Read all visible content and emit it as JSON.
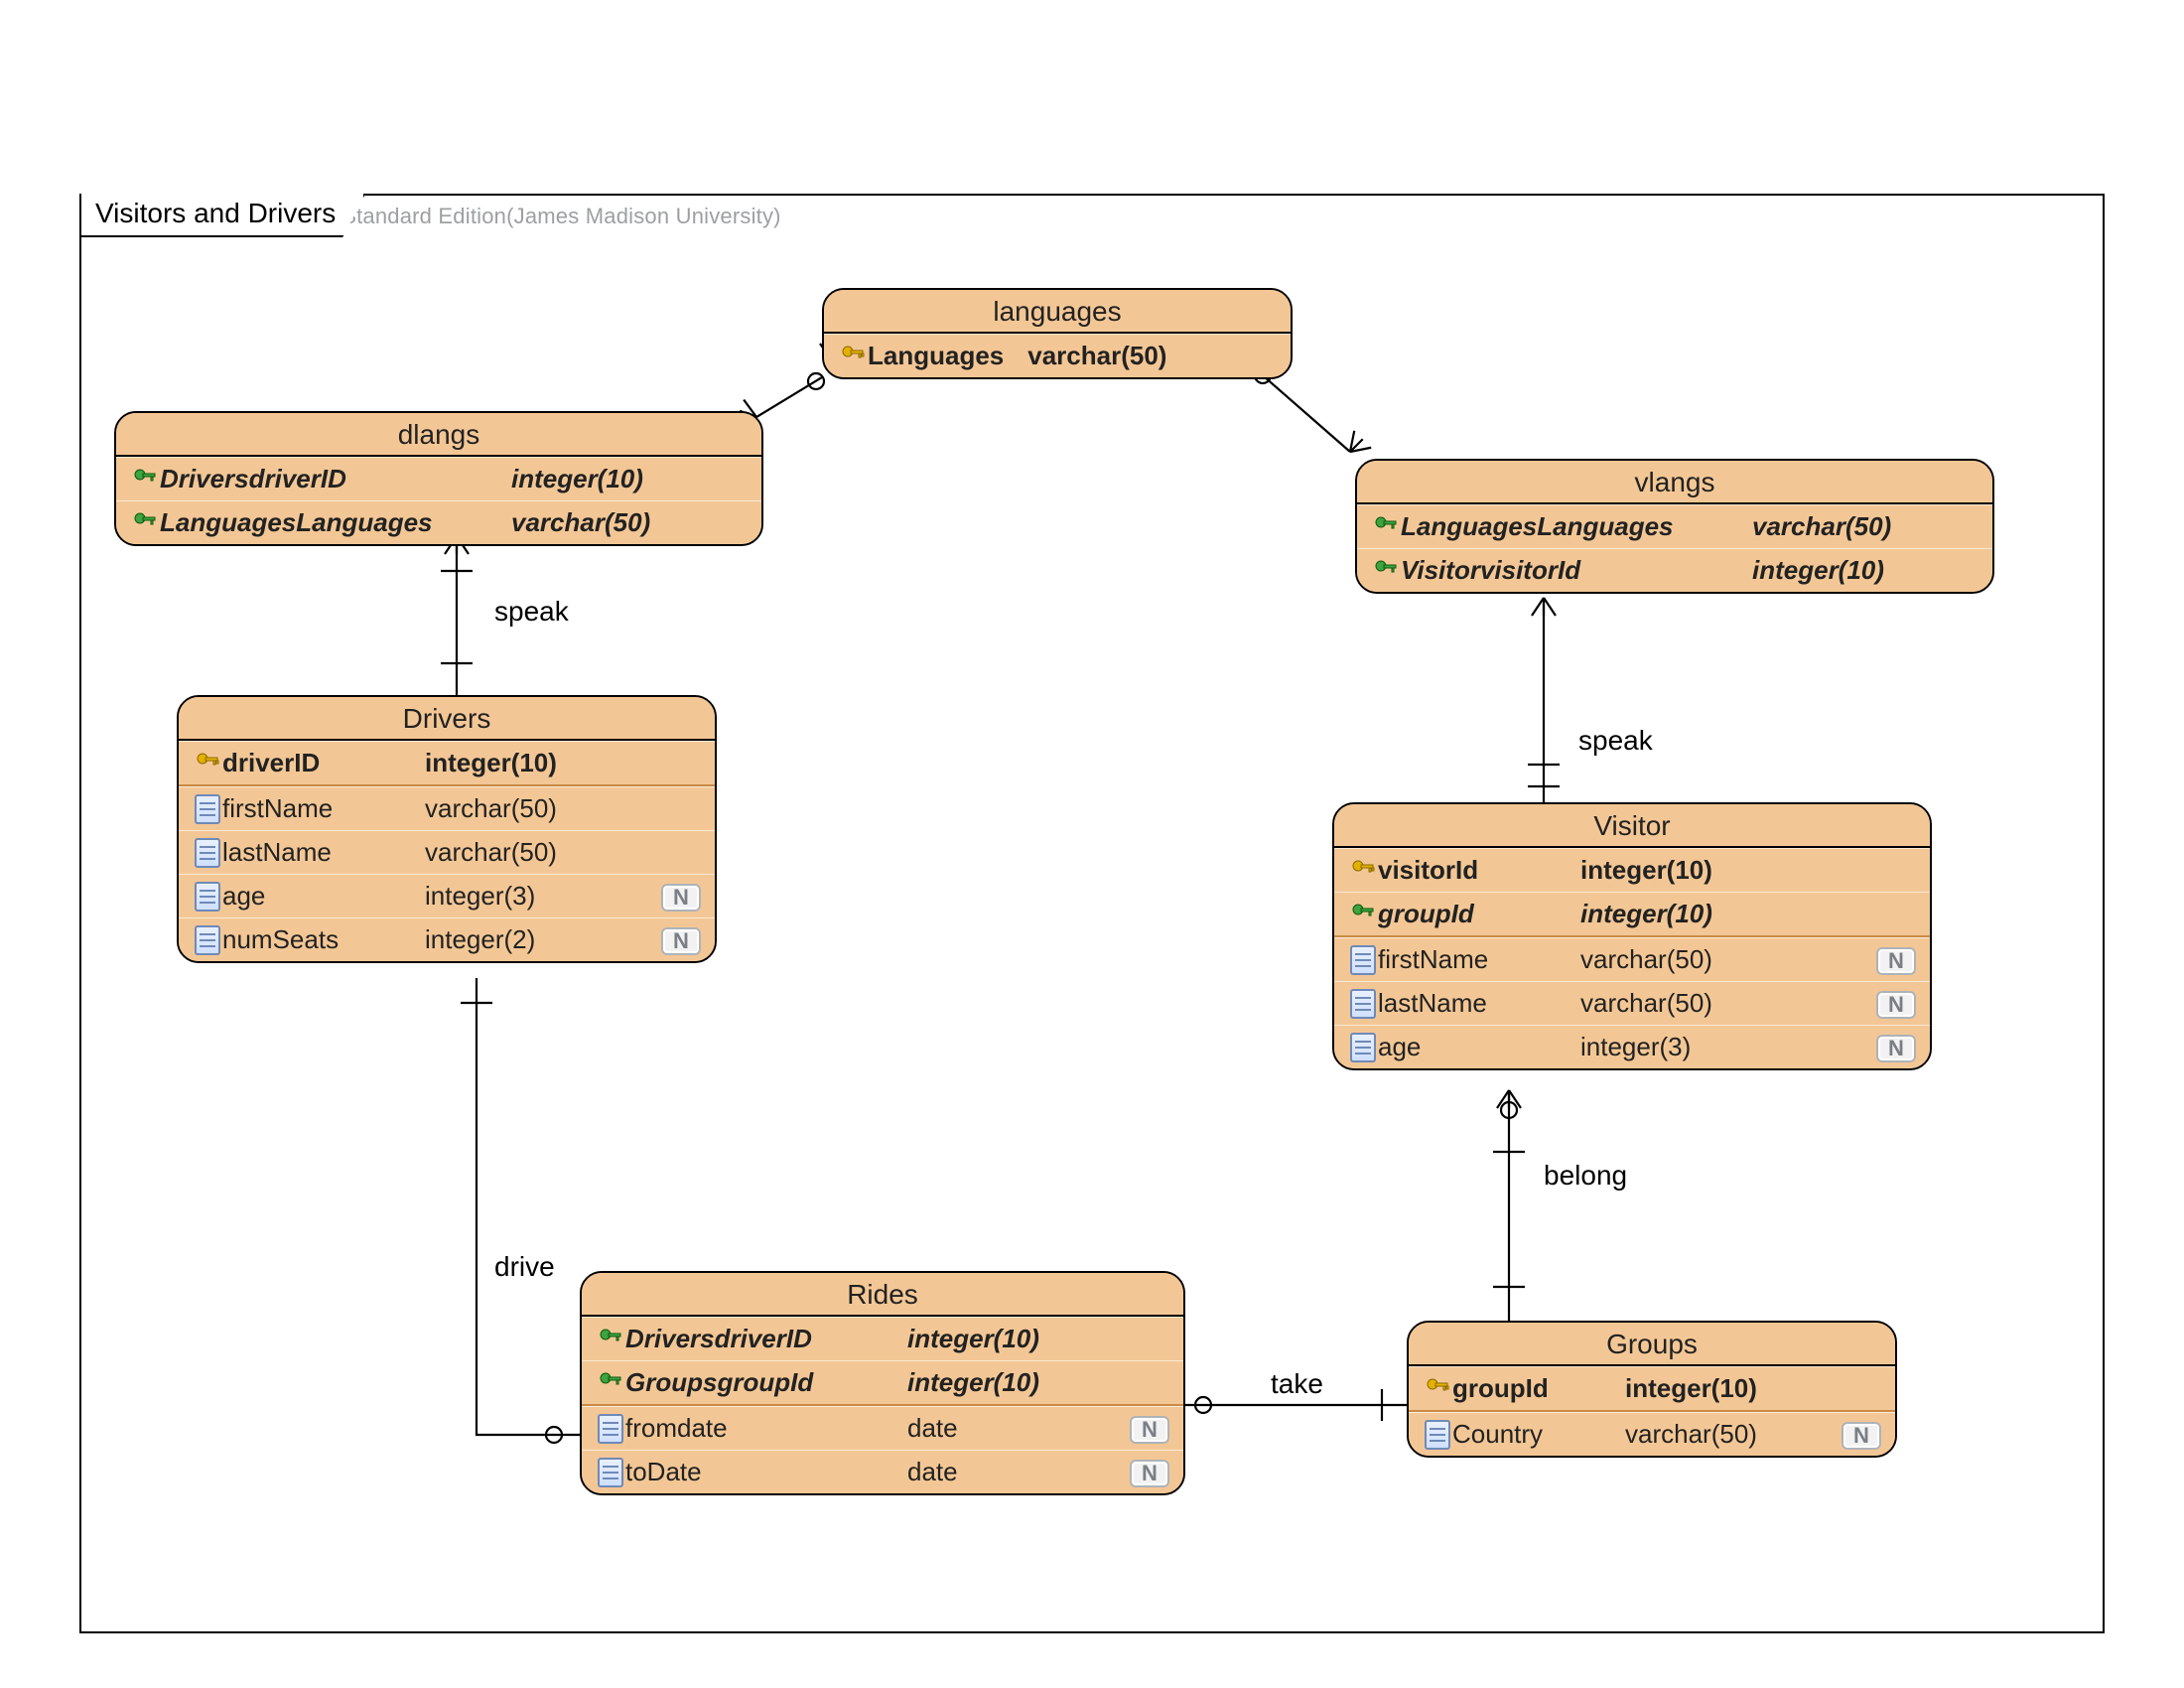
{
  "watermark": "Visual Paradigm for UML Standard Edition(James Madison University)",
  "frame_title": "Visitors and Drivers",
  "nullable_badge": "N",
  "relationships": {
    "speak1_label": "speak",
    "speak2_label": "speak",
    "drive_label": "drive",
    "take_label": "take",
    "belong_label": "belong"
  },
  "entities": {
    "languages": {
      "title": "languages",
      "rows": [
        {
          "icon": "pk",
          "name": "Languages",
          "type": "varchar(50)"
        }
      ]
    },
    "dlangs": {
      "title": "dlangs",
      "rows": [
        {
          "icon": "fk",
          "name": "DriversdriverID",
          "type": "integer(10)"
        },
        {
          "icon": "fk",
          "name": "LanguagesLanguages",
          "type": "varchar(50)"
        }
      ]
    },
    "vlangs": {
      "title": "vlangs",
      "rows": [
        {
          "icon": "fk",
          "name": "LanguagesLanguages",
          "type": "varchar(50)"
        },
        {
          "icon": "fk",
          "name": "VisitorvisitorId",
          "type": "integer(10)"
        }
      ]
    },
    "drivers": {
      "title": "Drivers",
      "rows": [
        {
          "icon": "pk",
          "name": "driverID",
          "type": "integer(10)"
        },
        {
          "icon": "col",
          "name": "firstName",
          "type": "varchar(50)"
        },
        {
          "icon": "col",
          "name": "lastName",
          "type": "varchar(50)"
        },
        {
          "icon": "col",
          "name": "age",
          "type": "integer(3)",
          "nullable": true
        },
        {
          "icon": "col",
          "name": "numSeats",
          "type": "integer(2)",
          "nullable": true
        }
      ]
    },
    "visitor": {
      "title": "Visitor",
      "rows": [
        {
          "icon": "pk",
          "name": "visitorId",
          "type": "integer(10)"
        },
        {
          "icon": "fk",
          "name": "groupId",
          "type": "integer(10)"
        },
        {
          "icon": "col",
          "name": "firstName",
          "type": "varchar(50)",
          "nullable": true
        },
        {
          "icon": "col",
          "name": "lastName",
          "type": "varchar(50)",
          "nullable": true
        },
        {
          "icon": "col",
          "name": "age",
          "type": "integer(3)",
          "nullable": true
        }
      ]
    },
    "rides": {
      "title": "Rides",
      "rows": [
        {
          "icon": "fk",
          "name": "DriversdriverID",
          "type": "integer(10)"
        },
        {
          "icon": "fk",
          "name": "GroupsgroupId",
          "type": "integer(10)"
        },
        {
          "icon": "col",
          "name": "fromdate",
          "type": "date",
          "nullable": true
        },
        {
          "icon": "col",
          "name": "toDate",
          "type": "date",
          "nullable": true
        }
      ]
    },
    "groups": {
      "title": "Groups",
      "rows": [
        {
          "icon": "pk",
          "name": "groupId",
          "type": "integer(10)"
        },
        {
          "icon": "col",
          "name": "Country",
          "type": "varchar(50)",
          "nullable": true
        }
      ]
    }
  }
}
